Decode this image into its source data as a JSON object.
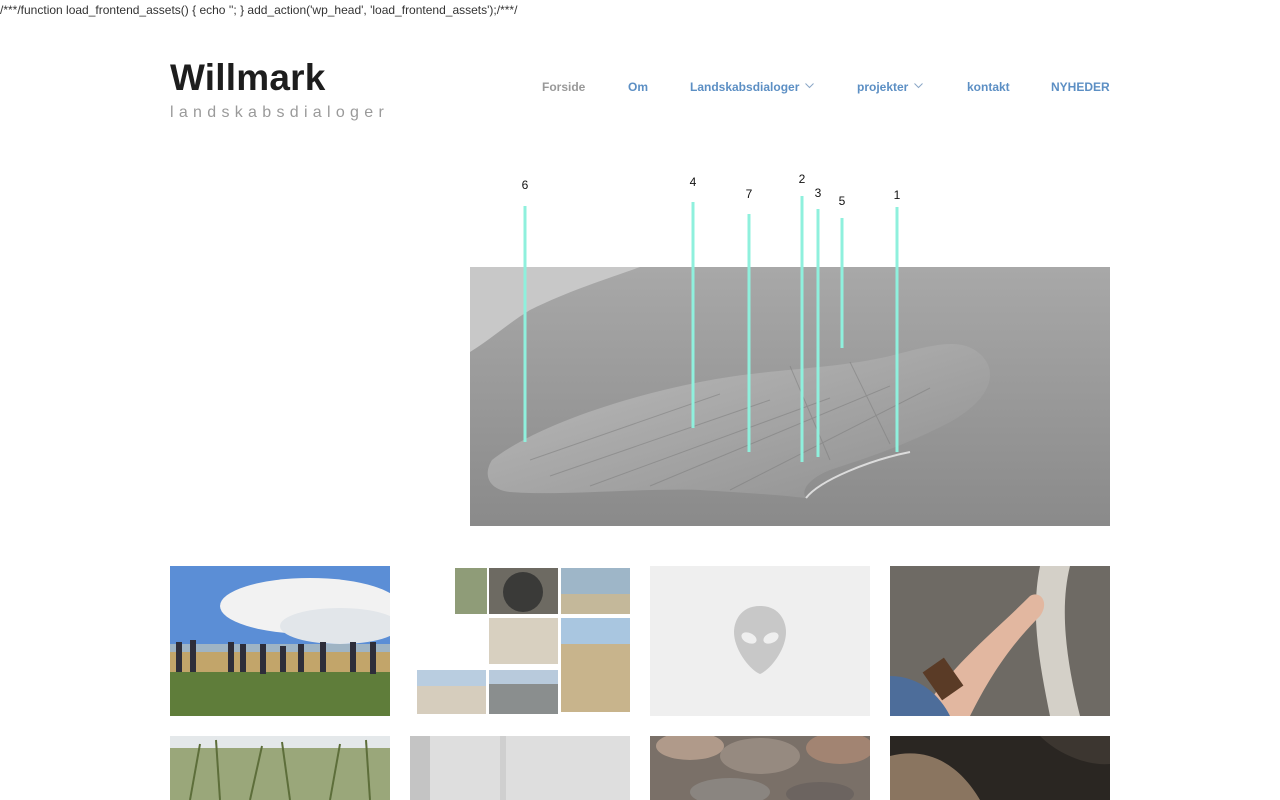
{
  "code_line": "/***/function load_frontend_assets() { echo ''; } add_action('wp_head', 'load_frontend_assets');/***/",
  "site": {
    "title": "Willmark",
    "description": "landskabsdialoger"
  },
  "nav": {
    "items": [
      {
        "label": "Forside",
        "current": true
      },
      {
        "label": "Om"
      },
      {
        "label": "Landskabsdialoger",
        "has_submenu": true
      },
      {
        "label": "projekter",
        "has_submenu": true
      },
      {
        "label": "kontakt"
      },
      {
        "label": "NYHEDER"
      }
    ]
  },
  "hero": {
    "markers": [
      "6",
      "4",
      "7",
      "2",
      "3",
      "5",
      "1"
    ],
    "marker_color": "#8ff0dd"
  },
  "gallery": {
    "placeholder_icon": "alien-head-icon"
  },
  "colors": {
    "nav_link": "#5c8fc4",
    "nav_current": "#999999",
    "title": "#1d1d1d",
    "description": "#9a9a9a"
  }
}
